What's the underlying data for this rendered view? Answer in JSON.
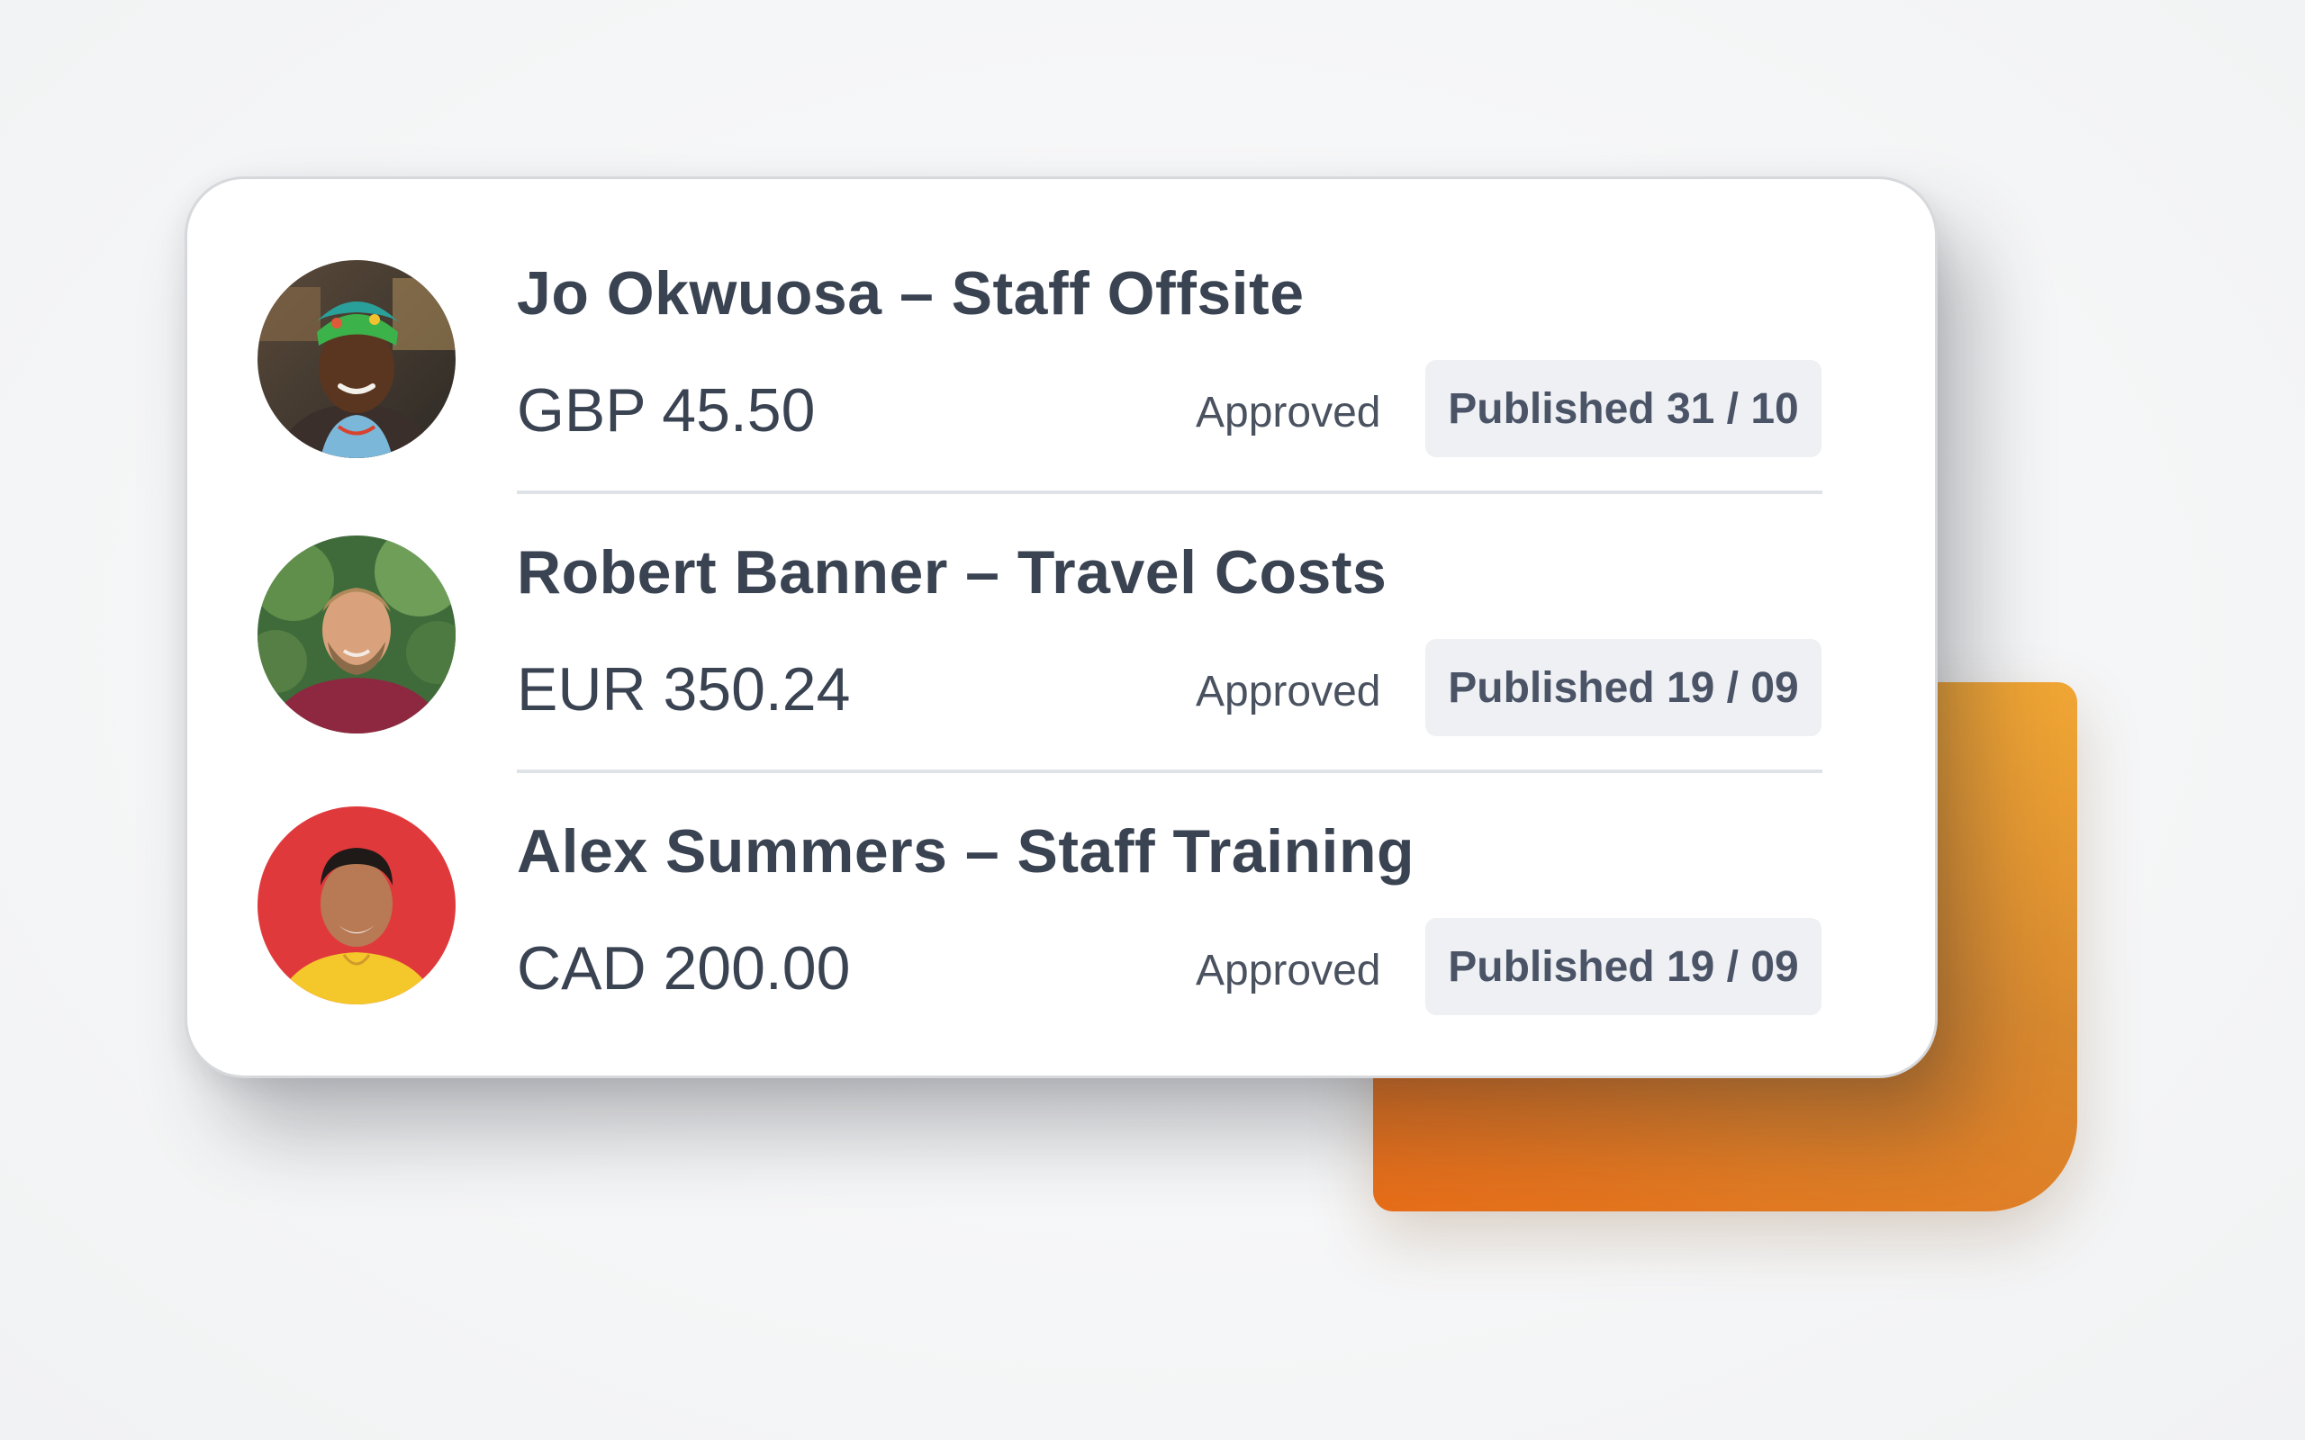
{
  "expenses": [
    {
      "title": "Jo Okwuosa – Staff Offsite",
      "amount": "GBP 45.50",
      "status": "Approved",
      "badge": "Published 31 / 10",
      "avatar": "jo-okwuosa-avatar"
    },
    {
      "title": "Robert Banner – Travel Costs",
      "amount": "EUR 350.24",
      "status": "Approved",
      "badge": "Published 19 / 09",
      "avatar": "robert-banner-avatar"
    },
    {
      "title": "Alex Summers – Staff Training",
      "amount": "CAD 200.00",
      "status": "Approved",
      "badge": "Published 19 / 09",
      "avatar": "alex-summers-avatar"
    }
  ],
  "colors": {
    "text": "#3a4352",
    "badge_bg": "#eef0f3",
    "accent_orange": "#e7721c",
    "accent_amber": "#f0a634"
  }
}
